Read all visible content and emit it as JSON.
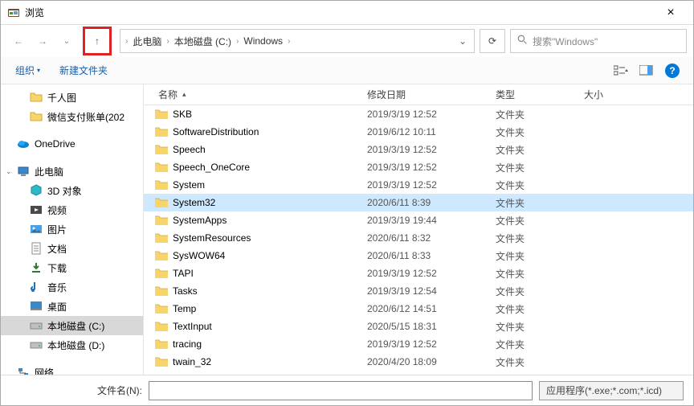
{
  "window": {
    "title": "浏览",
    "close_glyph": "×"
  },
  "nav": {
    "back_glyph": "←",
    "forward_glyph": "→",
    "up_glyph": "↑",
    "dropdown_glyph": "⌄",
    "refresh_glyph": "⟳"
  },
  "breadcrumbs": [
    "此电脑",
    "本地磁盘 (C:)",
    "Windows"
  ],
  "search": {
    "placeholder": "搜索\"Windows\""
  },
  "toolbar": {
    "organize": "组织",
    "organize_drop": "▾",
    "newfolder": "新建文件夹",
    "help_glyph": "?"
  },
  "columns": {
    "name": "名称",
    "date": "修改日期",
    "type": "类型",
    "size": "大小",
    "sort_glyph": "▴"
  },
  "sidebar": {
    "expand_glyph": "›",
    "collapse_glyph": "⌄",
    "items": [
      {
        "label": "千人图",
        "icon": "folder",
        "level": 1
      },
      {
        "label": "微信支付账单(202",
        "icon": "folder",
        "level": 1
      },
      {
        "label": "OneDrive",
        "icon": "onedrive",
        "level": 0,
        "spacer_before": true
      },
      {
        "label": "此电脑",
        "icon": "pc",
        "level": 0,
        "spacer_before": true,
        "expandable": true
      },
      {
        "label": "3D 对象",
        "icon": "cube",
        "level": 1
      },
      {
        "label": "视频",
        "icon": "video",
        "level": 1
      },
      {
        "label": "图片",
        "icon": "images",
        "level": 1
      },
      {
        "label": "文档",
        "icon": "doc",
        "level": 1
      },
      {
        "label": "下载",
        "icon": "download",
        "level": 1
      },
      {
        "label": "音乐",
        "icon": "music",
        "level": 1
      },
      {
        "label": "桌面",
        "icon": "desktop",
        "level": 1
      },
      {
        "label": "本地磁盘 (C:)",
        "icon": "disk",
        "level": 1,
        "selected": true
      },
      {
        "label": "本地磁盘 (D:)",
        "icon": "disk",
        "level": 1
      },
      {
        "label": "网络",
        "icon": "network",
        "level": 0,
        "spacer_before": true,
        "truncated": true
      }
    ]
  },
  "files": [
    {
      "name": "SKB",
      "date": "2019/3/19 12:52",
      "type": "文件夹"
    },
    {
      "name": "SoftwareDistribution",
      "date": "2019/6/12 10:11",
      "type": "文件夹"
    },
    {
      "name": "Speech",
      "date": "2019/3/19 12:52",
      "type": "文件夹"
    },
    {
      "name": "Speech_OneCore",
      "date": "2019/3/19 12:52",
      "type": "文件夹"
    },
    {
      "name": "System",
      "date": "2019/3/19 12:52",
      "type": "文件夹"
    },
    {
      "name": "System32",
      "date": "2020/6/11 8:39",
      "type": "文件夹",
      "selected": true
    },
    {
      "name": "SystemApps",
      "date": "2019/3/19 19:44",
      "type": "文件夹"
    },
    {
      "name": "SystemResources",
      "date": "2020/6/11 8:32",
      "type": "文件夹"
    },
    {
      "name": "SysWOW64",
      "date": "2020/6/11 8:33",
      "type": "文件夹"
    },
    {
      "name": "TAPI",
      "date": "2019/3/19 12:52",
      "type": "文件夹"
    },
    {
      "name": "Tasks",
      "date": "2019/3/19 12:54",
      "type": "文件夹"
    },
    {
      "name": "Temp",
      "date": "2020/6/12 14:51",
      "type": "文件夹"
    },
    {
      "name": "TextInput",
      "date": "2020/5/15 18:31",
      "type": "文件夹"
    },
    {
      "name": "tracing",
      "date": "2019/3/19 12:52",
      "type": "文件夹"
    },
    {
      "name": "twain_32",
      "date": "2020/4/20 18:09",
      "type": "文件夹"
    }
  ],
  "bottom": {
    "filename_label": "文件名(N):",
    "filter_label": "应用程序(*.exe;*.com;*.icd)"
  },
  "colors": {
    "selection": "#cde8ff",
    "sidebar_sel": "#d8d8d8",
    "link_blue": "#1a5ea8",
    "highlight_box": "#d22"
  }
}
